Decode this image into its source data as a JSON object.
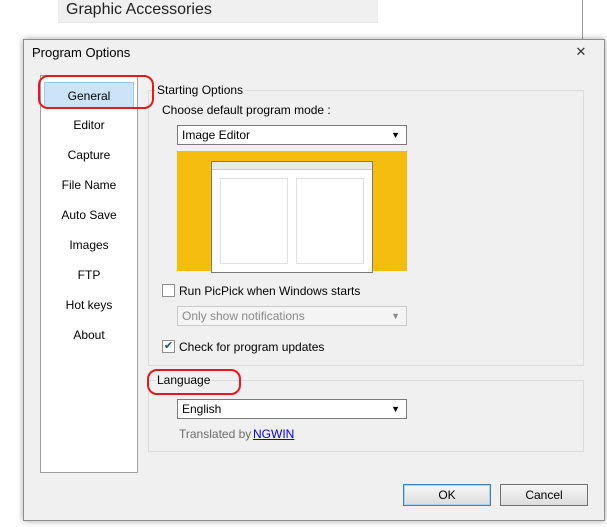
{
  "background": {
    "header_text": "Graphic Accessories"
  },
  "dialog": {
    "title": "Program Options",
    "close_glyph": "✕",
    "categories": [
      "General",
      "Editor",
      "Capture",
      "File Name",
      "Auto Save",
      "Images",
      "FTP",
      "Hot keys",
      "About"
    ],
    "selected_category": "General",
    "starting_options": {
      "title": "Starting Options",
      "mode_label": "Choose default program mode :",
      "mode_value": "Image Editor",
      "run_on_start_label": "Run PicPick when Windows starts",
      "run_on_start_checked": false,
      "notify_value": "Only show notifications",
      "check_updates_label": "Check for program updates",
      "check_updates_checked": true
    },
    "language": {
      "title": "Language",
      "value": "English",
      "translated_by_label": "Translated by",
      "translator": "NGWIN"
    },
    "buttons": {
      "ok": "OK",
      "cancel": "Cancel"
    }
  },
  "colors": {
    "accent": "#e21a1a",
    "preview_bg": "#f5bd10",
    "selection": "#cce4f7"
  },
  "icons": {
    "dropdown": "chevron-down-icon",
    "check": "check-icon",
    "close": "close-icon"
  }
}
